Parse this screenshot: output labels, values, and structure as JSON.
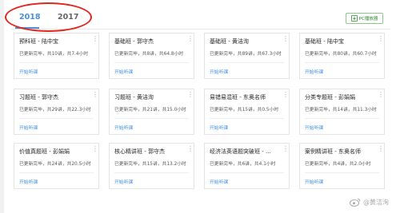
{
  "tabs": [
    {
      "label": "2018",
      "active": true
    },
    {
      "label": "2017",
      "active": false
    }
  ],
  "pc_player_button": {
    "label": "PC播放器",
    "icon": "download-icon"
  },
  "accent_color": "#4a90d9",
  "annotation_color": "#e0261f",
  "cards": [
    {
      "title": "预科班 - 陆中宝",
      "status": "已更新完毕，共10讲，共7.4小时",
      "action": "开始听课"
    },
    {
      "title": "基础班 - 郭守杰",
      "status": "已更新完毕，共8讲，共64.8小时",
      "action": "开始听课"
    },
    {
      "title": "基础班 - 黄洁洵",
      "status": "已更新完毕，共89讲，共67.3小时",
      "action": "开始听课"
    },
    {
      "title": "基础班 - 陆中宝",
      "status": "已更新完毕，共80讲，共60.7小时",
      "action": "开始听课"
    },
    {
      "title": "习题班 - 郭守杰",
      "status": "已更新完毕，共29讲，共22.3小时",
      "action": "开始听课"
    },
    {
      "title": "习题班 - 黄洁洵",
      "status": "已更新完毕，共21讲，共15.0小时",
      "action": "开始听课"
    },
    {
      "title": "易错易混班 - 东奥名师",
      "status": "已更新完毕，共15讲，共0.5小时",
      "action": "开始听课"
    },
    {
      "title": "分类专题班 - 彭娟娟",
      "status": "已更新完毕，共14讲，共11.3小时",
      "action": "开始听课"
    },
    {
      "title": "价值真题班 - 彭娟娟",
      "status": "已更新完毕，共24讲，共20.5小时",
      "action": "开始听课"
    },
    {
      "title": "核心精讲班 - 郭守杰",
      "status": "已更新完毕，共15讲，共13.2小时",
      "action": "开始听课"
    },
    {
      "title": "经济法英语题突破班 - ...",
      "status": "已更新完毕，共6讲，共4.1小时",
      "action": "开始听课"
    },
    {
      "title": "案例精讲班 - 东奥名师",
      "status": "已更新完毕，共4讲，共2.0小时",
      "action": "开始听课"
    }
  ],
  "watermark": {
    "text": "@黄洁洵",
    "icon": "weibo-icon"
  }
}
